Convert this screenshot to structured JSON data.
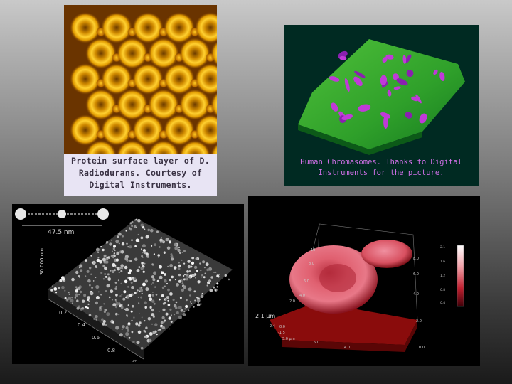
{
  "panel_protein": {
    "caption_lines": [
      "Protein surface layer of D.",
      "Radiodurans. Courtesy of",
      "Digital Instruments."
    ]
  },
  "panel_chromosomes": {
    "caption_lines": [
      "Human Chromasomes. Thanks to Digital",
      "Instruments for the picture."
    ]
  },
  "panel_afm": {
    "scale_label": "47.5 nm",
    "z_label": "30.000 nm",
    "axis_ticks": [
      "0.2",
      "0.4",
      "0.6",
      "0.8"
    ],
    "unit_label": "um"
  },
  "panel_cells": {
    "z_label": "2.1 µm",
    "left_ticks": [
      "10",
      "8.0",
      "6.0",
      "4.0",
      "2.0"
    ],
    "right_ticks": [
      "8.0",
      "6.0",
      "4.0",
      "2.0"
    ],
    "bottom_ticks": [
      "2.4",
      "0.0",
      "-1.5",
      "5.0 µm",
      "6.0",
      "4.0",
      "0.0"
    ],
    "colorbar_ticks": [
      "2.1",
      "1.6",
      "1.2",
      "0.8",
      "0.4"
    ]
  }
}
